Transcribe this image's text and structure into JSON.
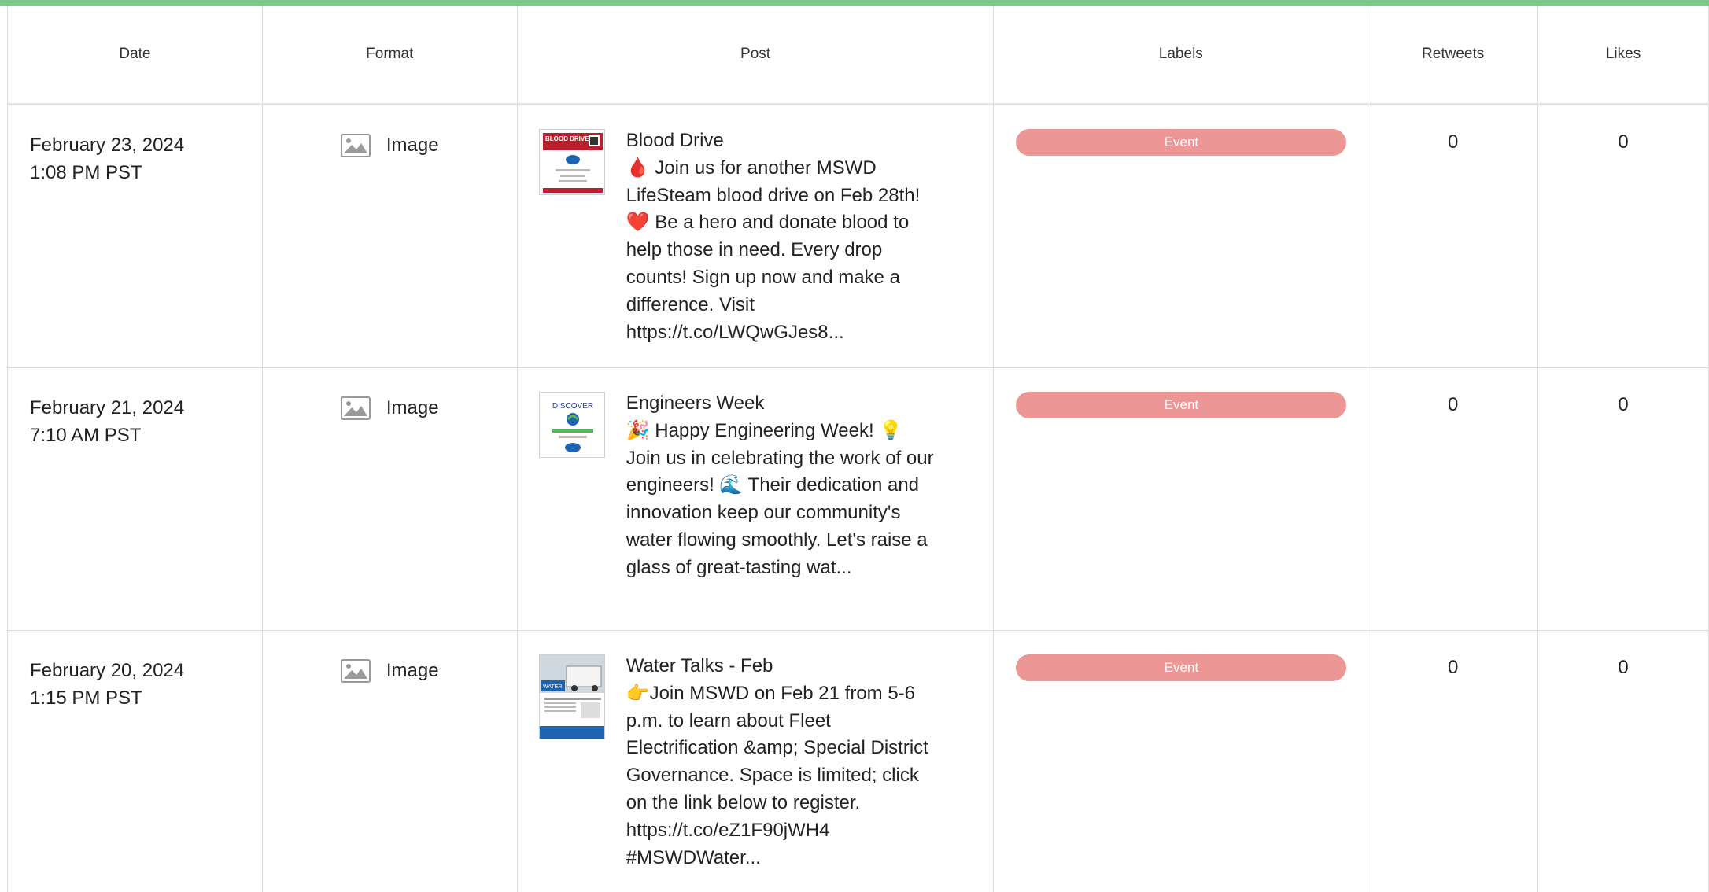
{
  "columns": {
    "date": "Date",
    "format": "Format",
    "post": "Post",
    "labels": "Labels",
    "retweets": "Retweets",
    "likes": "Likes"
  },
  "accent_color": "#7cc98a",
  "label_color": "#ec9696",
  "rows": [
    {
      "date": "February 23, 2024",
      "time": "1:08 PM PST",
      "format": "Image",
      "format_icon": "image-icon",
      "post_title": "Blood Drive",
      "post_body": "🩸 Join us for another MSWD LifeSteam blood drive on Feb 28th! ❤️ Be a hero and donate blood to help those in need. Every drop counts! Sign up now and make a difference. Visit https://t.co/LWQwGJes8...",
      "thumb_text": "BLOOD DRIVE",
      "label": "Event",
      "retweets": "0",
      "likes": "0"
    },
    {
      "date": "February 21, 2024",
      "time": "7:10 AM PST",
      "format": "Image",
      "format_icon": "image-icon",
      "post_title": "Engineers Week",
      "post_body": "🎉 Happy Engineering Week! 💡 Join us in celebrating the work of our engineers! 🌊 Their dedication and innovation keep our community's water flowing smoothly. Let's raise a glass of great-tasting wat...",
      "thumb_text": "DISCOVER",
      "label": "Event",
      "retweets": "0",
      "likes": "0"
    },
    {
      "date": "February 20, 2024",
      "time": "1:15 PM PST",
      "format": "Image",
      "format_icon": "image-icon",
      "post_title": "Water Talks - Feb",
      "post_body": "👉Join MSWD on Feb 21 from 5-6 p.m. to learn about Fleet Electrification &amp; Special District Governance. Space is limited; click on the link below to register. https://t.co/eZ1F90jWH4 #MSWDWater...",
      "thumb_text": "WATER",
      "label": "Event",
      "retweets": "0",
      "likes": "0"
    }
  ]
}
